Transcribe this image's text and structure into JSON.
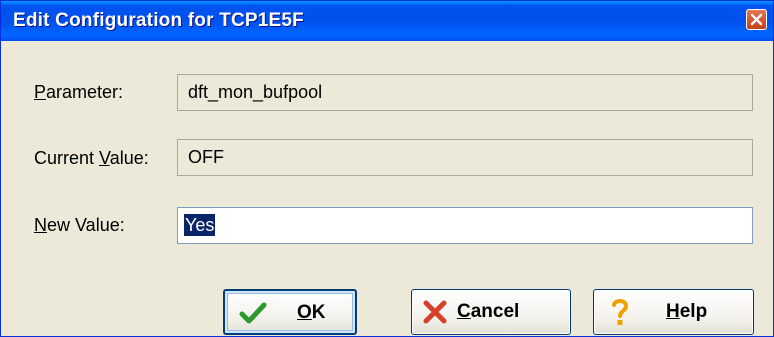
{
  "window": {
    "title": "Edit Configuration for TCP1E5F",
    "close_icon": "close-icon"
  },
  "form": {
    "parameter": {
      "label_prefix": "",
      "label_mnemonic": "P",
      "label_rest": "arameter:",
      "value": "dft_mon_bufpool"
    },
    "current_value": {
      "label_prefix": "Current ",
      "label_mnemonic": "V",
      "label_rest": "alue:",
      "value": "OFF"
    },
    "new_value": {
      "label_prefix": "",
      "label_mnemonic": "N",
      "label_rest": "ew Value:",
      "value": "Yes"
    }
  },
  "buttons": {
    "ok": {
      "mnemonic": "O",
      "rest": "K",
      "icon": "checkmark-icon"
    },
    "cancel": {
      "mnemonic": "C",
      "rest": "ancel",
      "icon": "x-cancel-icon"
    },
    "help": {
      "mnemonic": "H",
      "rest": "elp",
      "icon": "question-mark-icon"
    }
  },
  "colors": {
    "titlebar": "#0053ee",
    "dialog_bg": "#ece9d8",
    "selection": "#0a246a",
    "ok_icon": "#2e9a2e",
    "cancel_icon": "#d8402a",
    "help_icon": "#f0a000"
  }
}
